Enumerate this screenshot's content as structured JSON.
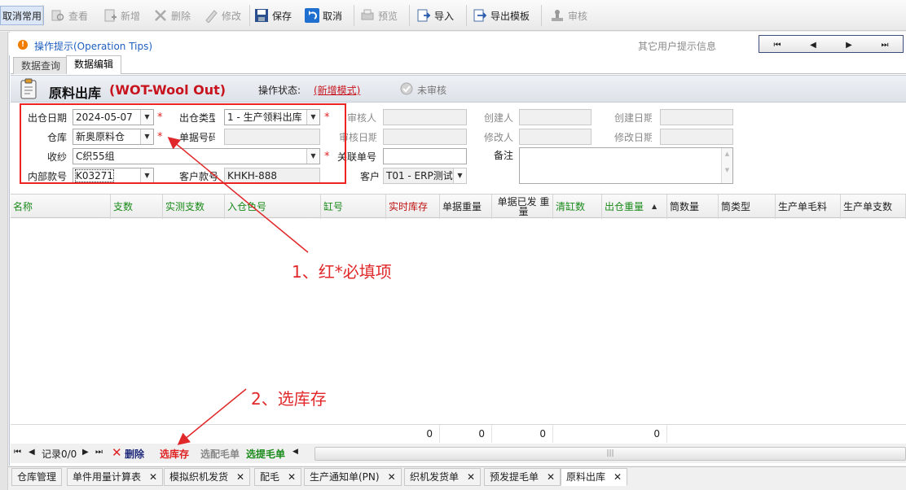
{
  "toolbar": {
    "items": [
      {
        "label": "取消常用",
        "icon": "cancel-favorite-icon",
        "enabled": true
      },
      {
        "label": "查看",
        "icon": "view-icon",
        "enabled": false
      },
      {
        "label": "新增",
        "icon": "new-doc-icon",
        "enabled": false
      },
      {
        "label": "删除",
        "icon": "delete-x-icon",
        "enabled": false
      },
      {
        "label": "修改",
        "icon": "edit-pencil-icon",
        "enabled": false
      },
      {
        "label": "保存",
        "icon": "save-disk-icon",
        "enabled": true
      },
      {
        "label": "取消",
        "icon": "undo-icon",
        "enabled": true
      },
      {
        "label": "预览",
        "icon": "preview-icon",
        "enabled": false
      },
      {
        "label": "导入",
        "icon": "import-icon",
        "enabled": true
      },
      {
        "label": "导出模板",
        "icon": "export-template-icon",
        "enabled": true
      },
      {
        "label": "审核",
        "icon": "approve-stamp-icon",
        "enabled": false
      }
    ]
  },
  "tips": {
    "label": "操作提示(Operation Tips)",
    "other_info": "其它用户提示信息",
    "nav": [
      "⏮",
      "◀",
      "▶",
      "⏭"
    ]
  },
  "tabs": [
    "数据查询",
    "数据编辑"
  ],
  "header": {
    "title": "原料出库",
    "code": "(WOT-Wool Out)",
    "status_label": "操作状态:",
    "status_value": "(新增模式)",
    "audit_status": "未审核"
  },
  "form": {
    "out_date_label": "出仓日期",
    "out_date": "2024-05-07",
    "out_type_label": "出仓类型",
    "out_type": "1 - 生产领料出库",
    "warehouse_label": "仓库",
    "warehouse": "新奥原料仓",
    "doc_no_label": "单据号码",
    "doc_no": "",
    "receiver_label": "收纱",
    "receiver": "C织55组",
    "related_no_label": "关联单号",
    "related_no": "",
    "internal_no_label": "内部款号",
    "internal_no": "K03271",
    "customer_style_label": "客户款号",
    "customer_style": "KHKH-888",
    "customer_label": "客户",
    "customer": "T01 - ERP测试",
    "reviewer_label": "审核人",
    "review_date_label": "审核日期",
    "creator_label": "创建人",
    "create_date_label": "创建日期",
    "modifier_label": "修改人",
    "modify_date_label": "修改日期",
    "note_label": "备注"
  },
  "grid": {
    "columns": [
      {
        "label": "名称",
        "style": "green"
      },
      {
        "label": "支数",
        "style": "green"
      },
      {
        "label": "实测支数",
        "style": "green"
      },
      {
        "label": "入仓色号",
        "style": "green"
      },
      {
        "label": "缸号",
        "style": "green"
      },
      {
        "label": "实时库存",
        "style": "red"
      },
      {
        "label": "单据重量",
        "style": "normal"
      },
      {
        "label": "单据已发 重量",
        "style": "normal"
      },
      {
        "label": "清缸数",
        "style": "green"
      },
      {
        "label": "出仓重量",
        "style": "green"
      },
      {
        "label": "筒数量",
        "style": "normal"
      },
      {
        "label": "筒类型",
        "style": "normal"
      },
      {
        "label": "生产单毛料",
        "style": "normal"
      },
      {
        "label": "生产单支数",
        "style": "normal"
      }
    ],
    "footer_totals": [
      "0",
      "0",
      "0",
      "0"
    ]
  },
  "navbar": {
    "record": "记录0/0",
    "delete": "删除",
    "select_stock": "选库存",
    "match_wool": "选配毛单",
    "pick_wool": "选提毛单"
  },
  "bottom_tabs": [
    "仓库管理",
    "单件用量计算表",
    "模拟织机发货",
    "配毛",
    "生产通知单(PN)",
    "织机发货单",
    "预发提毛单",
    "原料出库"
  ],
  "annotations": {
    "note1": "1、红*必填项",
    "note2": "2、选库存"
  },
  "colors": {
    "accent": "#1f5fbf",
    "required": "#e02020",
    "annotation": "#e0282a",
    "title_red": "#c8141e"
  }
}
